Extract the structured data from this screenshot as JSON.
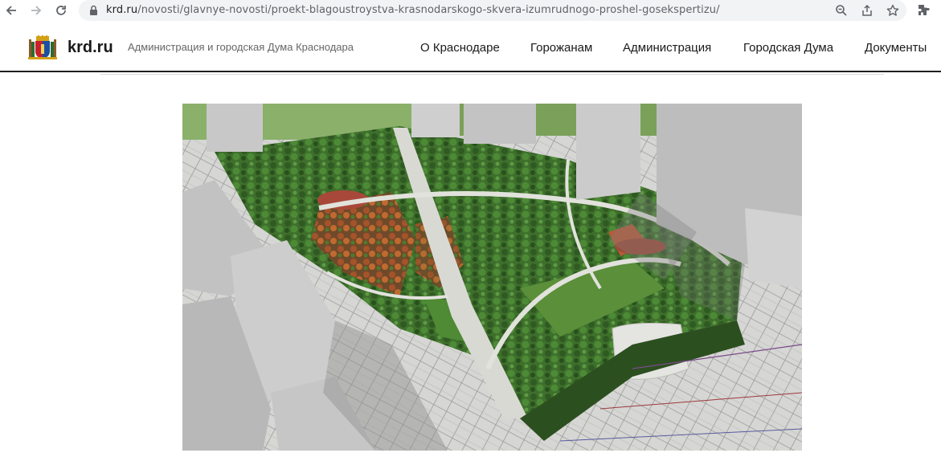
{
  "browser": {
    "url_host": "krd.ru",
    "url_path": "/novosti/glavnye-novosti/proekt-blagoustroystva-krasnodarskogo-skvera-izumrudnogo-proshel-gosekspertizu/",
    "icons": [
      "back-arrow-icon",
      "forward-arrow-icon",
      "reload-icon",
      "lock-icon",
      "zoom-icon",
      "share-icon",
      "star-icon",
      "extensions-icon"
    ]
  },
  "header": {
    "logo_text": "krd.ru",
    "logo_subtitle": "Администрация и городская Дума Краснодара",
    "nav": [
      {
        "label": "О Краснодаре"
      },
      {
        "label": "Горожанам"
      },
      {
        "label": "Администрация"
      },
      {
        "label": "Городская Дума"
      },
      {
        "label": "Документы"
      }
    ]
  },
  "colors": {
    "header_rule": "#1f1f1f",
    "url_bar_bg": "#f1f3f4",
    "park_green": "#3f7a2e",
    "path_color": "#d9d9d4"
  }
}
